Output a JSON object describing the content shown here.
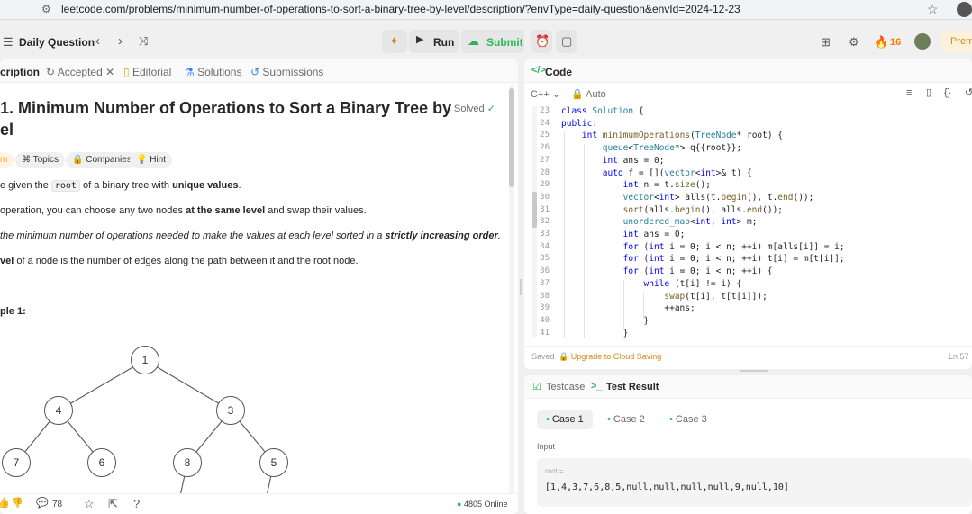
{
  "browser": {
    "url": "leetcode.com/problems/minimum-number-of-operations-to-sort-a-binary-tree-by-level/description/?envType=daily-question&envId=2024-12-23"
  },
  "nav": {
    "title": "Daily Question",
    "run_label": "Run",
    "submit_label": "Submit",
    "streak": "16",
    "premium": "Prem"
  },
  "left_tabs": {
    "description": "cription",
    "accepted": "Accepted",
    "editorial": "Editorial",
    "solutions": "Solutions",
    "submissions": "Submissions"
  },
  "problem": {
    "title_line1": "1. Minimum Number of Operations to Sort a Binary Tree by",
    "title_line2": "el",
    "solved": "Solved",
    "chips": {
      "first": "m",
      "topics": "Topics",
      "companies": "Companies",
      "hint": "Hint"
    },
    "p1_a": "e given the ",
    "p1_code": "root",
    "p1_b": " of a binary tree with ",
    "p1_bold": "unique values",
    "p1_c": ".",
    "p2_a": " operation, you can choose any two nodes ",
    "p2_bold": "at the same level",
    "p2_b": " and swap their values.",
    "p3_a": " the minimum number of operations needed to make the values at each level sorted in a ",
    "p3_bold": "strictly increasing order",
    "p3_b": ".",
    "p4_bold": "vel",
    "p4_a": " of a node is the number of edges along the path between it and the root node.",
    "example": "ple 1:",
    "tree_nodes": [
      "1",
      "4",
      "3",
      "7",
      "6",
      "8",
      "5"
    ]
  },
  "bottom_bar": {
    "comments": "78",
    "online": "4805 Online"
  },
  "code_panel": {
    "title": "Code",
    "language": "C++",
    "mode": "Auto",
    "saved": "Saved",
    "upgrade": "Upgrade to Cloud Saving",
    "cursor": "Ln 57",
    "lines": [
      {
        "n": "23",
        "t": "class Solution {"
      },
      {
        "n": "24",
        "t": "public:"
      },
      {
        "n": "25",
        "t": "    int minimumOperations(TreeNode* root) {"
      },
      {
        "n": "26",
        "t": "        queue<TreeNode*> q{{root}};"
      },
      {
        "n": "27",
        "t": "        int ans = 0;"
      },
      {
        "n": "28",
        "t": "        auto f = [](vector<int>& t) {"
      },
      {
        "n": "29",
        "t": "            int n = t.size();"
      },
      {
        "n": "30",
        "t": "            vector<int> alls(t.begin(), t.end());"
      },
      {
        "n": "31",
        "t": "            sort(alls.begin(), alls.end());"
      },
      {
        "n": "32",
        "t": "            unordered_map<int, int> m;"
      },
      {
        "n": "33",
        "t": "            int ans = 0;"
      },
      {
        "n": "34",
        "t": "            for (int i = 0; i < n; ++i) m[alls[i]] = i;"
      },
      {
        "n": "35",
        "t": "            for (int i = 0; i < n; ++i) t[i] = m[t[i]];"
      },
      {
        "n": "36",
        "t": "            for (int i = 0; i < n; ++i) {"
      },
      {
        "n": "37",
        "t": "                while (t[i] != i) {"
      },
      {
        "n": "38",
        "t": "                    swap(t[i], t[t[i]]);"
      },
      {
        "n": "39",
        "t": "                    ++ans;"
      },
      {
        "n": "40",
        "t": "                }"
      },
      {
        "n": "41",
        "t": "            }"
      }
    ]
  },
  "test_panel": {
    "testcase_tab": "Testcase",
    "result_tab": "Test Result",
    "cases": [
      "Case 1",
      "Case 2",
      "Case 3"
    ],
    "input_label": "Input",
    "var_name": "root =",
    "var_value": "[1,4,3,7,6,8,5,null,null,null,null,9,null,10]"
  }
}
